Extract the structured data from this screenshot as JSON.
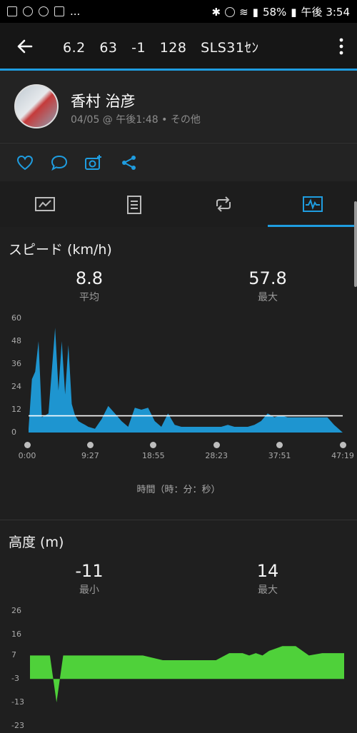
{
  "status_bar": {
    "battery": "58%",
    "time": "午後 3:54",
    "ellipsis": "..."
  },
  "app_bar": {
    "title": "6.2   63   -1   128   SLS31ｾﾝ"
  },
  "activity": {
    "user_name": "香村 治彦",
    "meta": "04/05 @ 午後1:48 • その他"
  },
  "speed": {
    "title": "スピード (km/h)",
    "avg_value": "8.8",
    "avg_label": "平均",
    "max_value": "57.8",
    "max_label": "最大",
    "y_ticks": [
      "60",
      "48",
      "36",
      "24",
      "12",
      "0"
    ],
    "x_ticks": [
      "0:00",
      "9:27",
      "18:55",
      "28:23",
      "37:51",
      "47:19"
    ],
    "x_title": "時間（時：分：秒）"
  },
  "altitude": {
    "title": "高度 (m)",
    "min_value": "-11",
    "min_label": "最小",
    "max_value": "14",
    "max_label": "最大",
    "y_ticks": [
      "26",
      "16",
      "7",
      "-3",
      "-13",
      "-23"
    ]
  },
  "chart_data": [
    {
      "type": "area",
      "title": "スピード (km/h)",
      "xlabel": "時間（時：分：秒）",
      "ylabel": "",
      "ylim": [
        0,
        60
      ],
      "x_range": [
        "0:00",
        "47:19"
      ],
      "color": "#1e95d0",
      "average": 8.8,
      "series": [
        {
          "x": [
            0,
            0.5,
            1,
            1.5,
            2,
            3,
            4,
            4.5,
            5,
            5.5,
            6,
            6.5,
            7,
            7.5,
            8,
            8.5,
            9,
            10,
            11,
            12,
            13,
            14,
            15,
            16,
            17,
            18,
            19,
            20,
            21,
            22,
            23,
            24,
            25,
            26,
            27,
            28,
            29,
            30,
            31,
            32,
            33,
            34,
            35,
            36,
            37,
            38,
            39,
            40,
            41,
            42,
            43,
            44,
            45,
            46,
            47.3
          ],
          "values": [
            2,
            28,
            32,
            48,
            8,
            10,
            55,
            22,
            48,
            20,
            46,
            15,
            9,
            6,
            5,
            4,
            3,
            2,
            7,
            14,
            10,
            6,
            3,
            13,
            12,
            13,
            6,
            3,
            10,
            4,
            3,
            3,
            3,
            3,
            3,
            3,
            3,
            4,
            3,
            3,
            3,
            4,
            6,
            10,
            8,
            9,
            8,
            8,
            8,
            8,
            8,
            8,
            8,
            4,
            0
          ]
        }
      ]
    },
    {
      "type": "area",
      "title": "高度 (m)",
      "xlabel": "",
      "ylabel": "",
      "ylim": [
        -23,
        26
      ],
      "color": "#4fd13a",
      "series": [
        {
          "x": [
            0,
            2,
            3,
            4,
            5,
            6,
            8,
            10,
            12,
            15,
            17,
            20,
            23,
            25,
            28,
            30,
            32,
            33,
            34,
            35,
            36,
            38,
            40,
            42,
            44,
            46,
            47.3
          ],
          "values": [
            7,
            7,
            7,
            -13,
            7,
            7,
            7,
            7,
            7,
            7,
            7,
            5,
            5,
            5,
            5,
            8,
            8,
            7,
            8,
            7,
            9,
            11,
            11,
            7,
            8,
            8,
            8
          ]
        }
      ]
    }
  ]
}
